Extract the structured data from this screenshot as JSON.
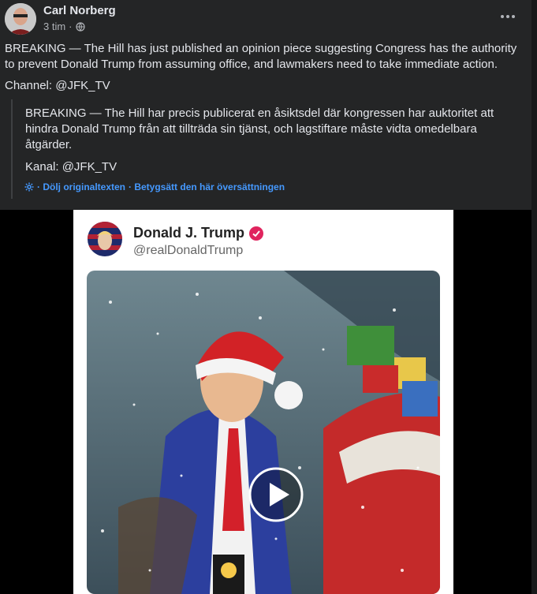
{
  "post": {
    "author": "Carl Norberg",
    "time": "3 tim",
    "separator": "·",
    "body": "BREAKING — The Hill has just published an opinion piece suggesting Congress has the authority to prevent Donald Trump from assuming office, and lawmakers need to take immediate action.",
    "channel": "Channel: @JFK_TV",
    "more_icon": "more-dots",
    "privacy_icon": "globe-icon"
  },
  "translation": {
    "body": "BREAKING — The Hill har precis publicerat en åsiktsdel där kongressen har auktoritet att hindra Donald Trump från att tillträda sin tjänst, och lagstiftare måste vidta omedelbara åtgärder.",
    "channel": "Kanal: @JFK_TV",
    "hide_original": "· Dölj originaltexten",
    "rate": "· Betygsätt den här översättningen",
    "settings_icon": "gear-icon"
  },
  "media": {
    "tweet_name": "Donald J. Trump",
    "tweet_handle": "@realDonaldTrump",
    "verified_color": "#e0245e",
    "play_icon": "play-icon"
  }
}
